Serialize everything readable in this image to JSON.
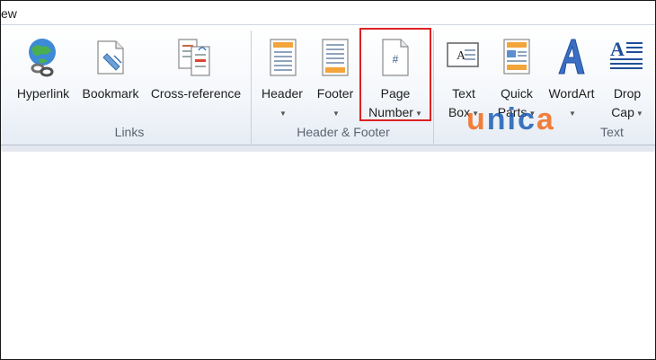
{
  "tab_partial": "ew",
  "groups": {
    "links": "Links",
    "header_footer": "Header & Footer",
    "text": "Text"
  },
  "commands": {
    "hyperlink": "Hyperlink",
    "bookmark": "Bookmark",
    "cross_reference": "Cross-reference",
    "header_line1": "Header",
    "footer_line1": "Footer",
    "page_number_line1": "Page",
    "page_number_line2": "Number",
    "text_box_line1": "Text",
    "text_box_line2": "Box",
    "quick_parts_line1": "Quick",
    "quick_parts_line2": "Parts",
    "wordart": "WordArt",
    "drop_cap_line1": "Drop",
    "drop_cap_line2": "Cap"
  },
  "watermark": {
    "orange": "u",
    "blue1": "ni",
    "blue2": "c",
    "orange2": "a"
  },
  "colors": {
    "highlight": "#dd2222",
    "watermark_orange": "#f26a1b",
    "watermark_blue": "#1c5fb4"
  }
}
